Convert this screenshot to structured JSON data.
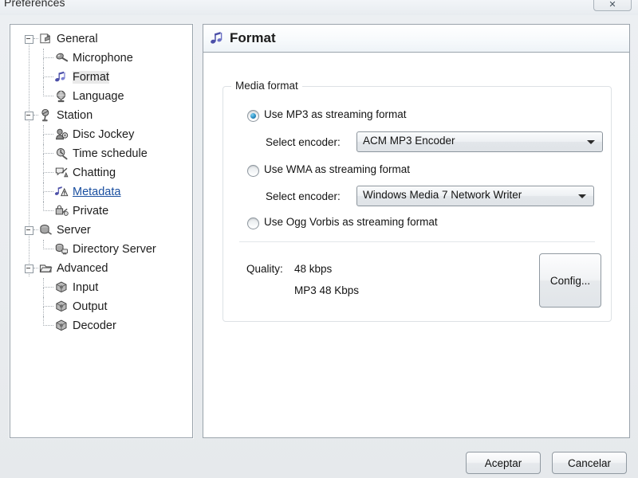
{
  "window": {
    "title": "Preferences",
    "close_glyph": "✕",
    "close_name": "close-button"
  },
  "sidebar": {
    "items": [
      {
        "label": "General",
        "level": 0,
        "icon": "general-icon",
        "state": "normal",
        "expander": true
      },
      {
        "label": "Microphone",
        "level": 1,
        "icon": "microphone-icon",
        "state": "normal",
        "expander": false
      },
      {
        "label": "Format",
        "level": 1,
        "icon": "format-music-icon",
        "state": "selected",
        "expander": false
      },
      {
        "label": "Language",
        "level": 1,
        "icon": "language-globe-icon",
        "state": "normal",
        "expander": false
      },
      {
        "label": "Station",
        "level": 0,
        "icon": "station-antenna-icon",
        "state": "normal",
        "expander": true
      },
      {
        "label": "Disc Jockey",
        "level": 1,
        "icon": "disc-jockey-icon",
        "state": "normal",
        "expander": false
      },
      {
        "label": "Time schedule",
        "level": 1,
        "icon": "time-schedule-icon",
        "state": "normal",
        "expander": false
      },
      {
        "label": "Chatting",
        "level": 1,
        "icon": "chatting-icon",
        "state": "normal",
        "expander": false
      },
      {
        "label": "Metadata",
        "level": 1,
        "icon": "metadata-icon",
        "state": "link",
        "expander": false
      },
      {
        "label": "Private",
        "level": 1,
        "icon": "private-lock-icon",
        "state": "normal",
        "expander": false
      },
      {
        "label": "Server",
        "level": 0,
        "icon": "server-icon",
        "state": "normal",
        "expander": true
      },
      {
        "label": "Directory Server",
        "level": 1,
        "icon": "directory-server-icon",
        "state": "normal",
        "expander": false
      },
      {
        "label": "Advanced",
        "level": 0,
        "icon": "advanced-folder-icon",
        "state": "normal",
        "expander": true
      },
      {
        "label": "Input",
        "level": 1,
        "icon": "input-cube-icon",
        "state": "normal",
        "expander": false
      },
      {
        "label": "Output",
        "level": 1,
        "icon": "output-cube-icon",
        "state": "normal",
        "expander": false
      },
      {
        "label": "Decoder",
        "level": 1,
        "icon": "decoder-cube-icon",
        "state": "normal",
        "expander": false
      }
    ]
  },
  "panel": {
    "header_title": "Format",
    "header_icon": "format-music-icon",
    "group_title": "Media format",
    "options": [
      {
        "label": "Use MP3 as streaming format",
        "selected": true
      },
      {
        "label": "Use WMA as streaming format",
        "selected": false
      },
      {
        "label": "Use Ogg Vorbis as streaming format",
        "selected": false
      }
    ],
    "encoder_label_mp3": "Select encoder:",
    "encoder_value_mp3": "ACM MP3 Encoder",
    "encoder_label_wma": "Select encoder:",
    "encoder_value_wma": "Windows Media 7 Network Writer",
    "quality_label": "Quality:",
    "quality_value": "48 kbps",
    "quality_detail": "MP3 48 Kbps",
    "config_button": "Config..."
  },
  "footer": {
    "ok_label": "Aceptar",
    "cancel_label": "Cancelar"
  },
  "colors": {
    "accent_link": "#1a4fa0",
    "radio_selected": "#2b8fc4",
    "panel_border": "#9aa3ab",
    "dialog_bg": "#eceff2"
  }
}
